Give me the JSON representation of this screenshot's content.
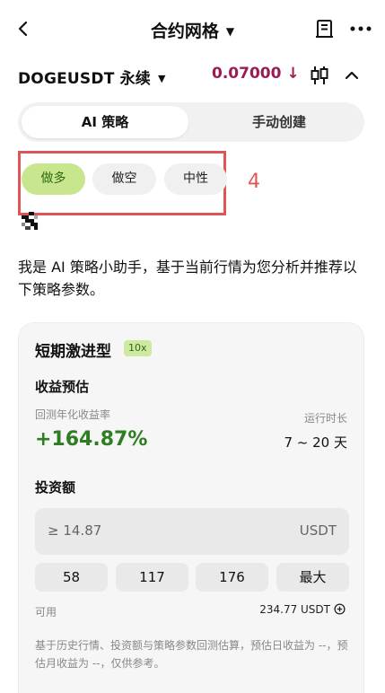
{
  "header": {
    "title": "合约网格"
  },
  "pair": {
    "symbol": "DOGEUSDT 永续",
    "price": "0.07000",
    "price_arrow": "↓",
    "price_color": "#9b1c55"
  },
  "tabs": [
    {
      "label": "AI 策略",
      "active": true
    },
    {
      "label": "手动创建",
      "active": false
    }
  ],
  "direction_chips": [
    {
      "label": "做多",
      "selected": true
    },
    {
      "label": "做空",
      "selected": false
    },
    {
      "label": "中性",
      "selected": false
    }
  ],
  "annotation": {
    "number": "4",
    "color": "#e05656"
  },
  "intro_text": "我是 AI 策略小助手，基于当前行情为您分析并推荐以下策略参数。",
  "card": {
    "title": "短期激进型",
    "leverage": "10x",
    "income_section": "收益预估",
    "yield_label": "回测年化收益率",
    "yield_value": "+164.87%",
    "yield_color": "#2e7d22",
    "duration_label": "运行时长",
    "duration_value": "7 ~ 20 天",
    "invest_section": "投资额",
    "amount_value": "≥ 14.87",
    "amount_unit": "USDT",
    "quick_amounts": [
      "58",
      "117",
      "176",
      "最大"
    ],
    "available_label": "可用",
    "available_value": "234.77 USDT",
    "disclaimer": "基于历史行情、投资额与策略参数回测估算，预估日收益为 --，预估月收益为 --，仅供参考。"
  },
  "icons": {
    "back": "back-arrow-icon",
    "title_caret": "caret-down-icon",
    "document": "document-icon",
    "more": "more-icon",
    "pair_caret": "caret-down-icon",
    "candlestick": "candlestick-icon",
    "collapse": "chevron-up-icon",
    "assistant": "pixel-avatar-icon",
    "add": "plus-circle-icon"
  }
}
